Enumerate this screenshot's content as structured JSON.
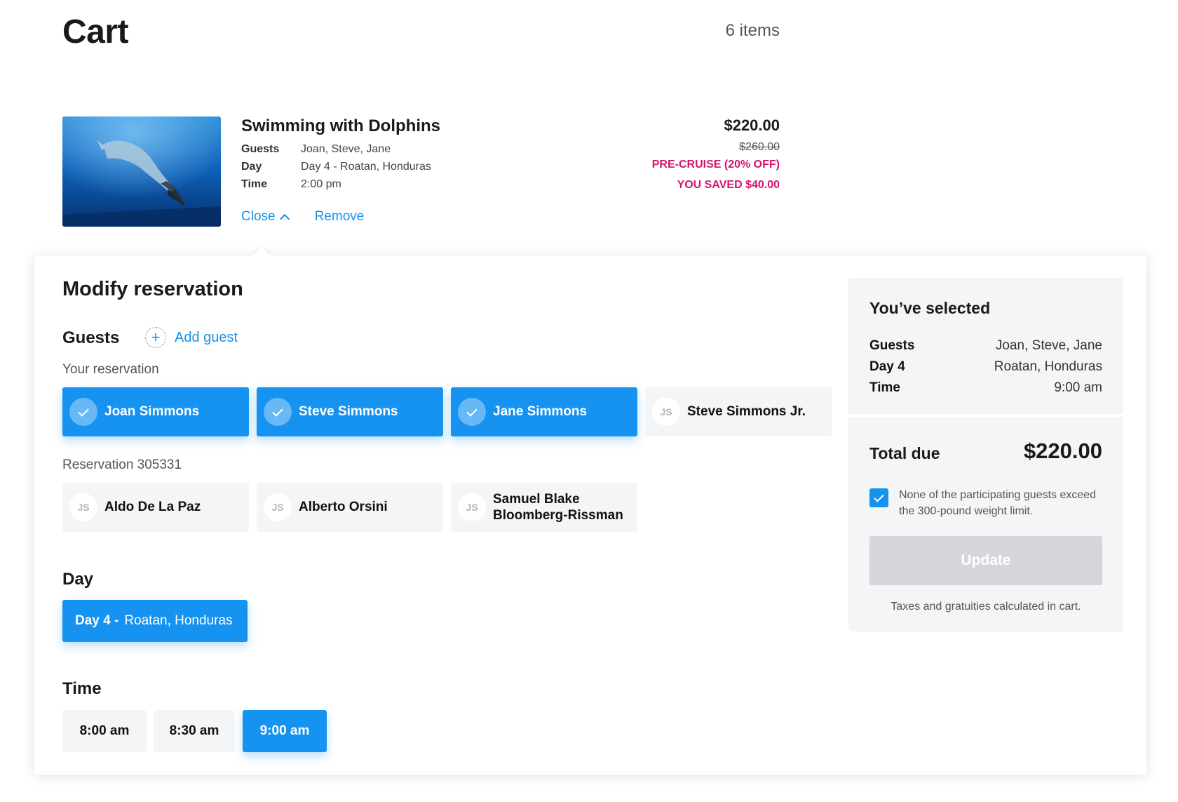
{
  "header": {
    "title": "Cart",
    "count": "6 items"
  },
  "item": {
    "name": "Swimming with Dolphins",
    "details": [
      {
        "key": "Guests",
        "value": "Joan, Steve, Jane"
      },
      {
        "key": "Day",
        "value": "Day 4 - Roatan, Honduras"
      },
      {
        "key": "Time",
        "value": "2:00 pm"
      }
    ],
    "close_label": "Close",
    "remove_label": "Remove",
    "price": "$220.00",
    "original_price": "$260.00",
    "promo": "PRE-CRUISE (20% OFF)",
    "saved": "YOU SAVED $40.00"
  },
  "modify": {
    "title": "Modify reservation",
    "guests_heading": "Guests",
    "add_guest": "Add guest",
    "your_reservation_label": "Your reservation",
    "your_guests": [
      {
        "name": "Joan Simmons",
        "selected": true
      },
      {
        "name": "Steve Simmons",
        "selected": true
      },
      {
        "name": "Jane Simmons",
        "selected": true
      },
      {
        "name": "Steve Simmons Jr.",
        "selected": false,
        "initials": "JS"
      }
    ],
    "other_reservation_label": "Reservation 305331",
    "other_guests": [
      {
        "name": "Aldo De La Paz",
        "initials": "JS"
      },
      {
        "name": "Alberto Orsini",
        "initials": "JS"
      },
      {
        "name_line1": "Samuel Blake",
        "name_line2": "Bloomberg-Rissman",
        "initials": "JS"
      }
    ],
    "day_heading": "Day",
    "day_option": {
      "day": "Day 4 -",
      "place": "Roatan, Honduras"
    },
    "time_heading": "Time",
    "time_options": [
      {
        "label": "8:00 am",
        "selected": false
      },
      {
        "label": "8:30 am",
        "selected": false
      },
      {
        "label": "9:00 am",
        "selected": true
      }
    ]
  },
  "summary": {
    "title": "You’ve selected",
    "rows": [
      {
        "key": "Guests",
        "value": "Joan, Steve, Jane"
      },
      {
        "key": "Day 4",
        "value": "Roatan, Honduras"
      },
      {
        "key": "Time",
        "value": "9:00 am"
      }
    ],
    "total_label": "Total due",
    "total_value": "$220.00",
    "weight_agreement": "None of the participating guests exceed the 300-pound weight limit.",
    "weight_agreement_checked": true,
    "update_label": "Update",
    "update_enabled": false,
    "tax_note": "Taxes and gratuities calculated in cart."
  },
  "colors": {
    "accent": "#1692f0",
    "promo": "#d6136e",
    "panel_gray": "#f4f5f7"
  },
  "icons": [
    "chevron-up-icon",
    "plus-icon",
    "check-icon"
  ]
}
